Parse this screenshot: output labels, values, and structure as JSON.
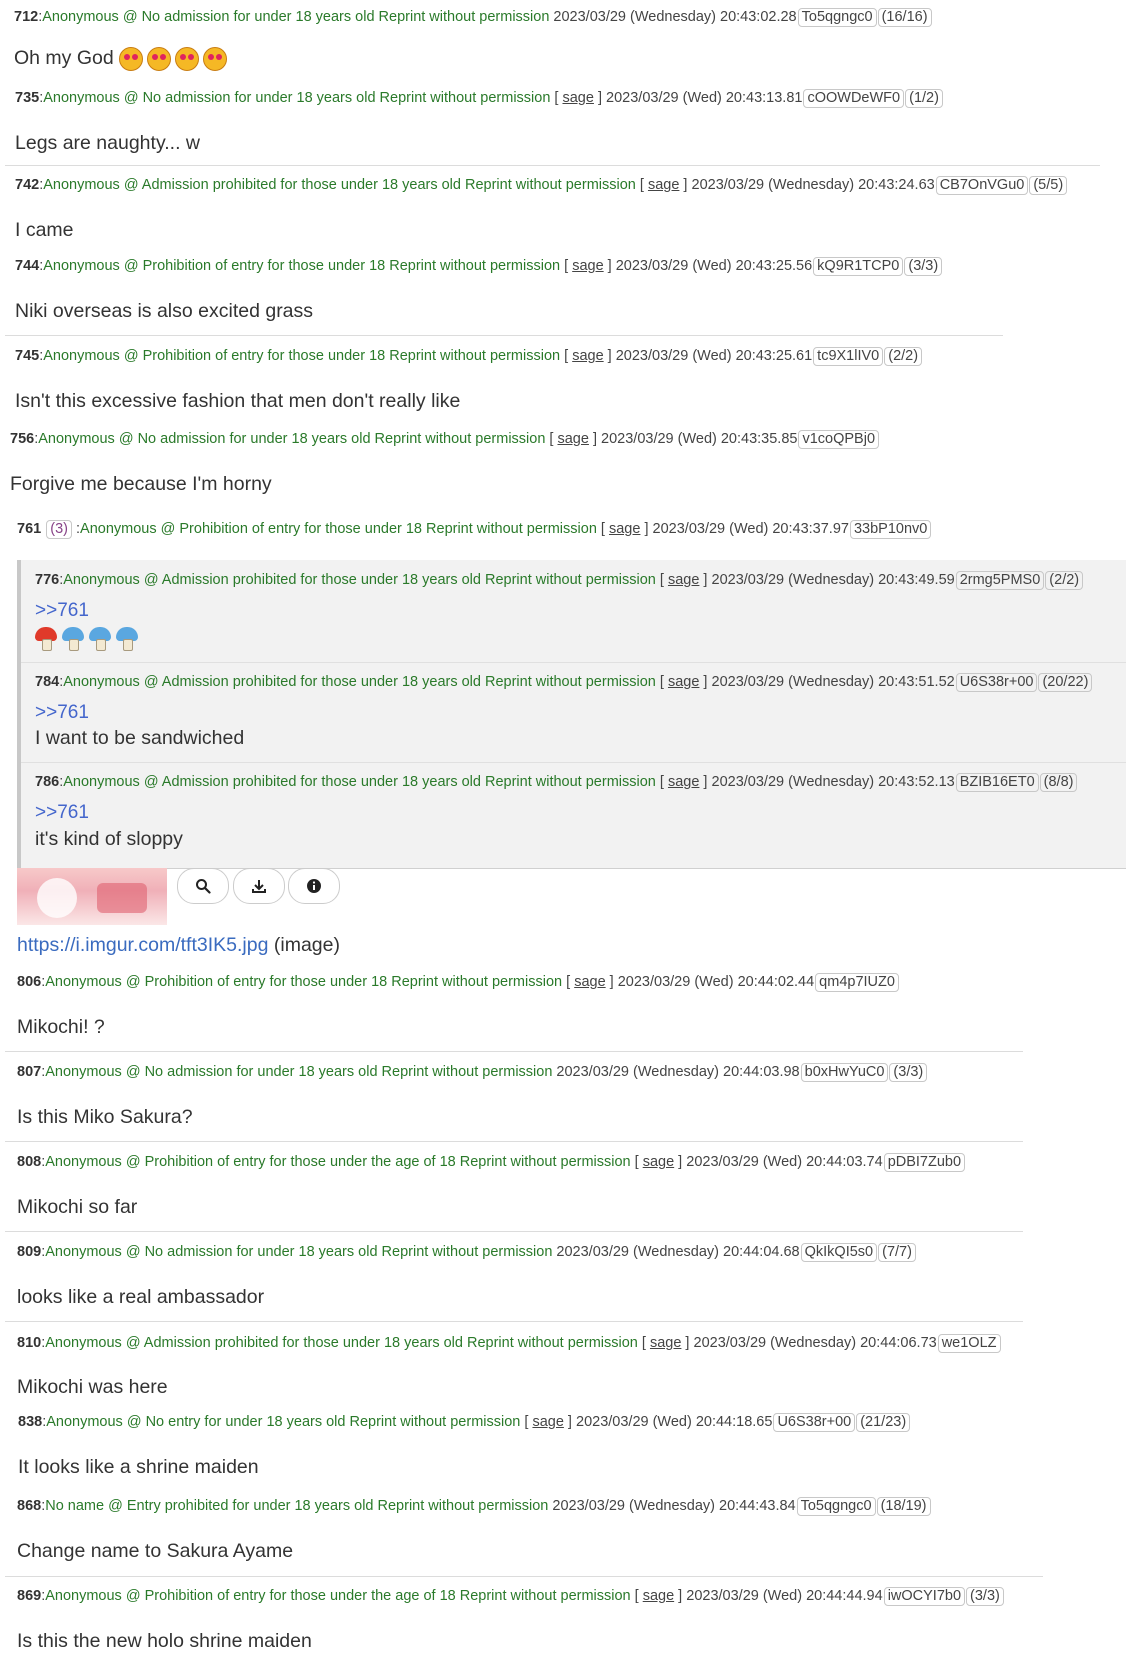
{
  "posts": [
    {
      "num": "712",
      "name": "Anonymous @ No admission for under 18 years old Reprint without permission",
      "sage": "",
      "date": "2023/03/29 (Wednesday) 20:43:02.28",
      "id": "To5qgngc0",
      "count": "(16/16)",
      "body": "Oh my God"
    },
    {
      "num": "735",
      "name": "Anonymous @ No admission for under 18 years old Reprint without permission",
      "sage": "sage",
      "date": "2023/03/29 (Wed) 20:43:13.81",
      "id": "cOOWDeWF0",
      "count": "(1/2)",
      "body": "Legs are naughty... w"
    },
    {
      "num": "742",
      "name": "Anonymous @ Admission prohibited for those under 18 years old Reprint without permission",
      "sage": "sage",
      "date": "2023/03/29 (Wednesday) 20:43:24.63",
      "id": "CB7OnVGu0",
      "count": "(5/5)",
      "body": "I came"
    },
    {
      "num": "744",
      "name": "Anonymous @ Prohibition of entry for those under 18 Reprint without permission",
      "sage": "sage",
      "date": "2023/03/29 (Wed) 20:43:25.56",
      "id": "kQ9R1TCP0",
      "count": "(3/3)",
      "body": "Niki overseas is also excited grass"
    },
    {
      "num": "745",
      "name": "Anonymous @ Prohibition of entry for those under 18 Reprint without permission",
      "sage": "sage",
      "date": "2023/03/29 (Wed) 20:43:25.61",
      "id": "tc9X1lIV0",
      "count": "(2/2)",
      "body": "Isn't this excessive fashion that men don't really like"
    },
    {
      "num": "756",
      "name": "Anonymous @ No admission for under 18 years old Reprint without permission",
      "sage": "sage",
      "date": "2023/03/29 (Wed) 20:43:35.85",
      "id": "v1coQPBj0",
      "count": "",
      "body": "Forgive me because I'm horny"
    },
    {
      "num": "761",
      "name": "Anonymous @ Prohibition of entry for those under 18 Reprint without permission",
      "sage": "sage",
      "date": "2023/03/29 (Wed) 20:43:37.97",
      "id": "33bP10nv0",
      "count": "",
      "replies": "(3)",
      "body": ""
    },
    {
      "num": "806",
      "name": "Anonymous @ Prohibition of entry for those under 18 Reprint without permission",
      "sage": "sage",
      "date": "2023/03/29 (Wed) 20:44:02.44",
      "id": "qm4p7IUZ0",
      "count": "",
      "body": "Mikochi! ?"
    },
    {
      "num": "807",
      "name": "Anonymous @ No admission for under 18 years old Reprint without permission",
      "sage": "",
      "date": "2023/03/29 (Wednesday) 20:44:03.98",
      "id": "b0xHwYuC0",
      "count": "(3/3)",
      "body": "Is this Miko Sakura?"
    },
    {
      "num": "808",
      "name": "Anonymous @ Prohibition of entry for those under the age of 18 Reprint without permission",
      "sage": "sage",
      "date": "2023/03/29 (Wed) 20:44:03.74",
      "id": "pDBI7Zub0",
      "count": "",
      "body": "Mikochi so far"
    },
    {
      "num": "809",
      "name": "Anonymous @ No admission for under 18 years old Reprint without permission",
      "sage": "",
      "date": "2023/03/29 (Wednesday) 20:44:04.68",
      "id": "QkIkQI5s0",
      "count": "(7/7)",
      "body": "looks like a real ambassador"
    },
    {
      "num": "810",
      "name": "Anonymous @ Admission prohibited for those under 18 years old Reprint without permission",
      "sage": "sage",
      "date": "2023/03/29 (Wednesday) 20:44:06.73",
      "id": "we1OLZ",
      "count": "",
      "body": "Mikochi was here"
    },
    {
      "num": "838",
      "name": "Anonymous @ No entry for under 18 years old Reprint without permission",
      "sage": "sage",
      "date": "2023/03/29 (Wed) 20:44:18.65",
      "id": "U6S38r+00",
      "count": "(21/23)",
      "body": "It looks like a shrine maiden"
    },
    {
      "num": "868",
      "name": "No name @ Entry prohibited for under 18 years old Reprint without permission",
      "sage": "",
      "date": "2023/03/29 (Wednesday) 20:44:43.84",
      "id": "To5qgngc0",
      "count": "(18/19)",
      "body": "Change name to Sakura Ayame"
    },
    {
      "num": "869",
      "name": "Anonymous @ Prohibition of entry for those under the age of 18 Reprint without permission",
      "sage": "sage",
      "date": "2023/03/29 (Wed) 20:44:44.94",
      "id": "iwOCYI7b0",
      "count": "(3/3)",
      "body": "Is this the new holo shrine maiden"
    }
  ],
  "replies": [
    {
      "num": "776",
      "name": "Anonymous @ Admission prohibited for those under 18 years old Reprint without permission",
      "sage": "sage",
      "date": "2023/03/29 (Wednesday) 20:43:49.59",
      "id": "2rmg5PMS0",
      "count": "(2/2)",
      "quote": ">>761",
      "body": ""
    },
    {
      "num": "784",
      "name": "Anonymous @ Admission prohibited for those under 18 years old Reprint without permission",
      "sage": "sage",
      "date": "2023/03/29 (Wednesday) 20:43:51.52",
      "id": "U6S38r+00",
      "count": "(20/22)",
      "quote": ">>761",
      "body": "I want to be sandwiched"
    },
    {
      "num": "786",
      "name": "Anonymous @ Admission prohibited for those under 18 years old Reprint without permission",
      "sage": "sage",
      "date": "2023/03/29 (Wednesday) 20:43:52.13",
      "id": "BZIB16ET0",
      "count": "(8/8)",
      "quote": ">>761",
      "body": "it's kind of sloppy"
    }
  ],
  "media": {
    "link_text": "https://i.imgur.com/tft3IK5.jpg",
    "link_suffix": "(image)",
    "icons": [
      "search-icon",
      "download-icon",
      "info-icon"
    ]
  },
  "labels": {
    "sage": "sage"
  }
}
